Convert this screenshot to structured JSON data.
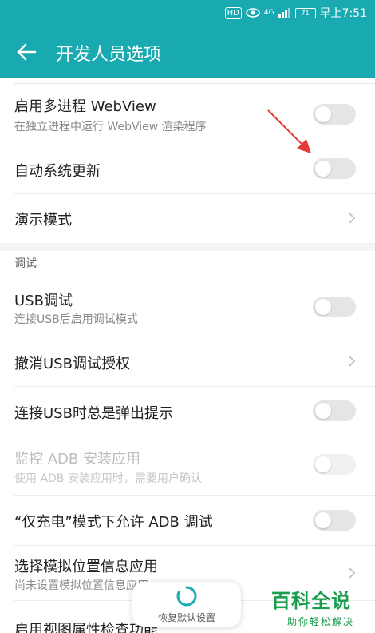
{
  "status_bar": {
    "hd_label": "HD",
    "signal_label": "4G",
    "battery": "71",
    "time": "早上7:51"
  },
  "app_bar": {
    "back_icon": "arrow-left-icon",
    "title": "开发人员选项"
  },
  "settings": [
    {
      "title": "启用多进程 WebView",
      "subtitle": "在独立进程中运行 WebView 渲染程序",
      "control": "toggle",
      "state": "off"
    },
    {
      "title": "自动系统更新",
      "control": "toggle",
      "state": "off"
    },
    {
      "title": "演示模式",
      "control": "chevron"
    }
  ],
  "debug_section": {
    "header": "调试",
    "items": [
      {
        "title": "USB调试",
        "subtitle": "连接USB后启用调试模式",
        "control": "toggle",
        "state": "off"
      },
      {
        "title": "撤消USB调试授权",
        "control": "chevron"
      },
      {
        "title": "连接USB时总是弹出提示",
        "control": "toggle",
        "state": "off"
      },
      {
        "title": "监控 ADB 安装应用",
        "subtitle": "使用 ADB 安装应用时，需要用户确认",
        "control": "toggle",
        "state": "off",
        "disabled": true
      },
      {
        "title": "“仅充电”模式下允许 ADB 调试",
        "control": "toggle",
        "state": "off"
      },
      {
        "title": "选择模拟位置信息应用",
        "subtitle": "尚未设置模拟位置信息应用",
        "control": "chevron"
      },
      {
        "title": "启用视图属性检查功能",
        "control": "toggle",
        "state": "off"
      }
    ]
  },
  "restore_button": {
    "label": "恢复默认设置",
    "icon": "refresh-ring-icon"
  },
  "watermark": {
    "main": "百科全说",
    "sub": "助你轻松解决"
  },
  "colors": {
    "accent": "#19a9b0",
    "annotation_arrow": "#e53935",
    "watermark": "#1a9e4e"
  }
}
